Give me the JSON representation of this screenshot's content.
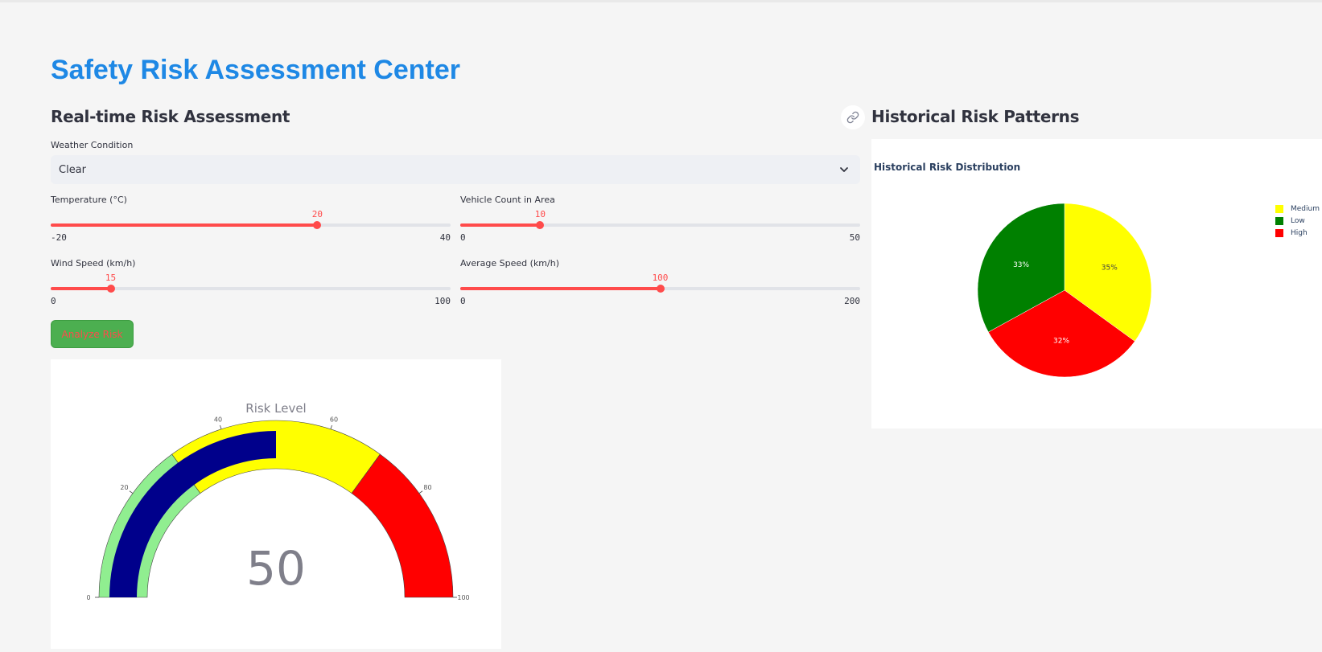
{
  "page": {
    "title": "Safety Risk Assessment Center"
  },
  "left": {
    "subheader": "Real-time Risk Assessment",
    "weather": {
      "label": "Weather Condition",
      "value": "Clear"
    },
    "sliders": [
      {
        "label": "Temperature (°C)",
        "value": 20,
        "min": -20,
        "max": 40,
        "value_text": "20",
        "min_text": "-20",
        "max_text": "40"
      },
      {
        "label": "Vehicle Count in Area",
        "value": 10,
        "min": 0,
        "max": 50,
        "value_text": "10",
        "min_text": "0",
        "max_text": "50"
      },
      {
        "label": "Wind Speed (km/h)",
        "value": 15,
        "min": 0,
        "max": 100,
        "value_text": "15",
        "min_text": "0",
        "max_text": "100"
      },
      {
        "label": "Average Speed (km/h)",
        "value": 100,
        "min": 0,
        "max": 200,
        "value_text": "100",
        "min_text": "0",
        "max_text": "200"
      }
    ],
    "analyze_button": "Analyze Risk"
  },
  "right": {
    "subheader": "Historical Risk Patterns"
  },
  "colors": {
    "title_blue": "#1e88e5",
    "slider_red": "#ff4b4b",
    "button_green": "#4caf50",
    "gauge_low": "#90ee90",
    "gauge_medium": "#ffff00",
    "gauge_high": "#ff0000",
    "gauge_bar": "#00008b",
    "pie_medium": "#ffff00",
    "pie_low": "#008000",
    "pie_high": "#ff0000"
  },
  "icons": {
    "anchor_link": "link-icon",
    "select_caret": "chevron-down-icon"
  },
  "chart_data": [
    {
      "type": "gauge",
      "title": "Risk Level",
      "value": 50,
      "value_text": "50",
      "range": [
        0,
        100
      ],
      "ticks": [
        {
          "value": 0,
          "label": "0"
        },
        {
          "value": 20,
          "label": "20"
        },
        {
          "value": 40,
          "label": "40"
        },
        {
          "value": 60,
          "label": "60"
        },
        {
          "value": 80,
          "label": "80"
        },
        {
          "value": 100,
          "label": "100"
        }
      ],
      "steps": [
        {
          "range": [
            0,
            30
          ],
          "color": "#90ee90"
        },
        {
          "range": [
            30,
            70
          ],
          "color": "#ffff00"
        },
        {
          "range": [
            70,
            100
          ],
          "color": "#ff0000"
        }
      ],
      "bar_color": "#00008b"
    },
    {
      "type": "pie",
      "title": "Historical Risk Distribution",
      "slices": [
        {
          "label": "Medium",
          "value": 35,
          "text": "35%",
          "color": "#ffff00"
        },
        {
          "label": "High",
          "value": 32,
          "text": "32%",
          "color": "#ff0000"
        },
        {
          "label": "Low",
          "value": 33,
          "text": "33%",
          "color": "#008000"
        }
      ],
      "legend_order": [
        "Medium",
        "Low",
        "High"
      ],
      "legend_position": "right"
    }
  ]
}
